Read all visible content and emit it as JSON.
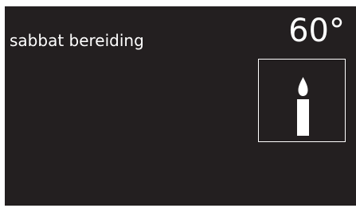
{
  "display": {
    "mode_label": "sabbat bereiding",
    "temperature": "60°"
  },
  "icons": {
    "mode_icon": "candle-icon"
  },
  "colors": {
    "background": "#231f20",
    "foreground": "#ffffff"
  }
}
